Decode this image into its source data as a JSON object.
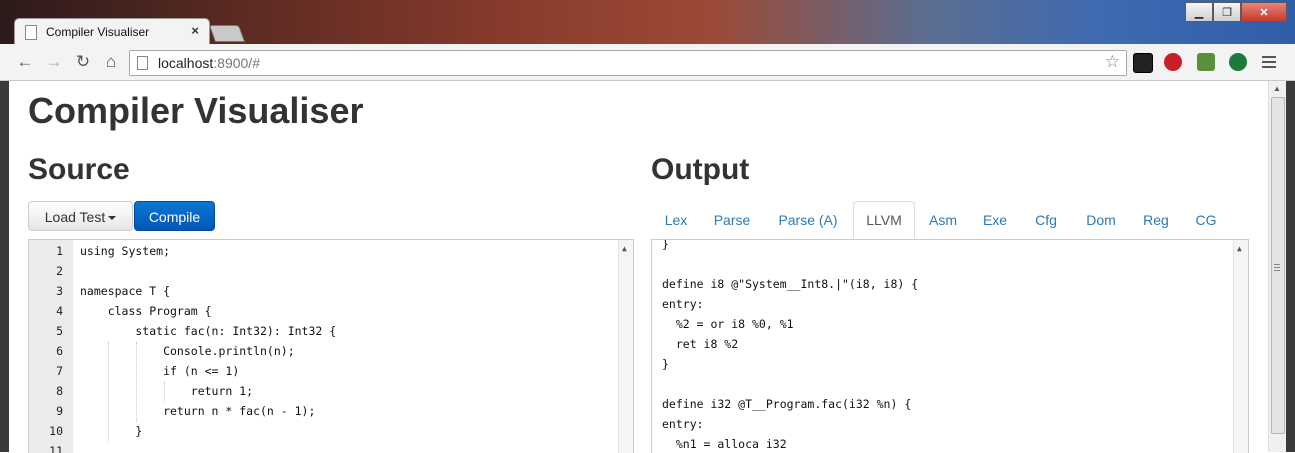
{
  "browser": {
    "tab_title": "Compiler Visualiser",
    "tab_close": "×",
    "url_host": "localhost",
    "url_rest": ":8900/#",
    "window_buttons": [
      "▁",
      "❐",
      "✕"
    ]
  },
  "page": {
    "title": "Compiler Visualiser",
    "source_heading": "Source",
    "output_heading": "Output",
    "load_test_label": "Load Test",
    "compile_label": "Compile"
  },
  "source": {
    "line_numbers": [
      "1",
      "2",
      "3",
      "4",
      "5",
      "6",
      "7",
      "8",
      "9",
      "10",
      "11"
    ],
    "lines": [
      "using System;",
      "",
      "namespace T {",
      "    class Program {",
      "        static fac(n: Int32): Int32 {",
      "            Console.println(n);",
      "            if (n <= 1)",
      "                return 1;",
      "            return n * fac(n - 1);",
      "        }",
      ""
    ]
  },
  "output": {
    "tabs": [
      "Lex",
      "Parse",
      "Parse (A)",
      "LLVM",
      "Asm",
      "Exe",
      "Cfg",
      "Dom",
      "Reg",
      "CG"
    ],
    "active_tab": "LLVM",
    "lines": [
      "}",
      "",
      "define i8 @\"System__Int8.|\"(i8, i8) {",
      "entry:",
      "  %2 = or i8 %0, %1",
      "  ret i8 %2",
      "}",
      "",
      "define i32 @T__Program.fac(i32 %n) {",
      "entry:",
      "  %n1 = alloca i32"
    ]
  },
  "colors": {
    "primary_button": "#0556b3",
    "tab_link": "#2a7ab8",
    "heading": "#333333"
  },
  "icons": [
    "back-arrow-icon",
    "forward-arrow-icon",
    "reload-icon",
    "home-icon",
    "page-icon",
    "star-icon",
    "menu-icon"
  ]
}
